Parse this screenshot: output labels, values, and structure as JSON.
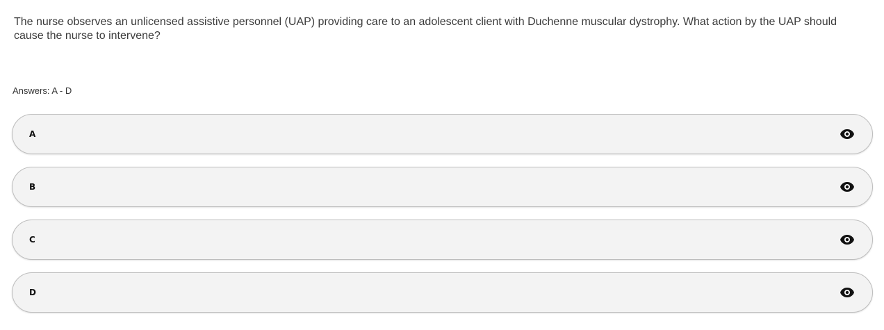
{
  "question": {
    "text": "The nurse observes an unlicensed assistive personnel (UAP) providing care to an adolescent client with Duchenne muscular dystrophy. What action by the UAP should cause the nurse to intervene?"
  },
  "answers_label": "Answers: A - D",
  "options": [
    {
      "letter": "A",
      "icon": "eye-icon"
    },
    {
      "letter": "B",
      "icon": "eye-icon"
    },
    {
      "letter": "C",
      "icon": "eye-icon"
    },
    {
      "letter": "D",
      "icon": "eye-icon"
    }
  ],
  "colors": {
    "option_background": "#f3f3f3",
    "option_border": "#bdbdbd",
    "text": "#3b3b3b"
  }
}
